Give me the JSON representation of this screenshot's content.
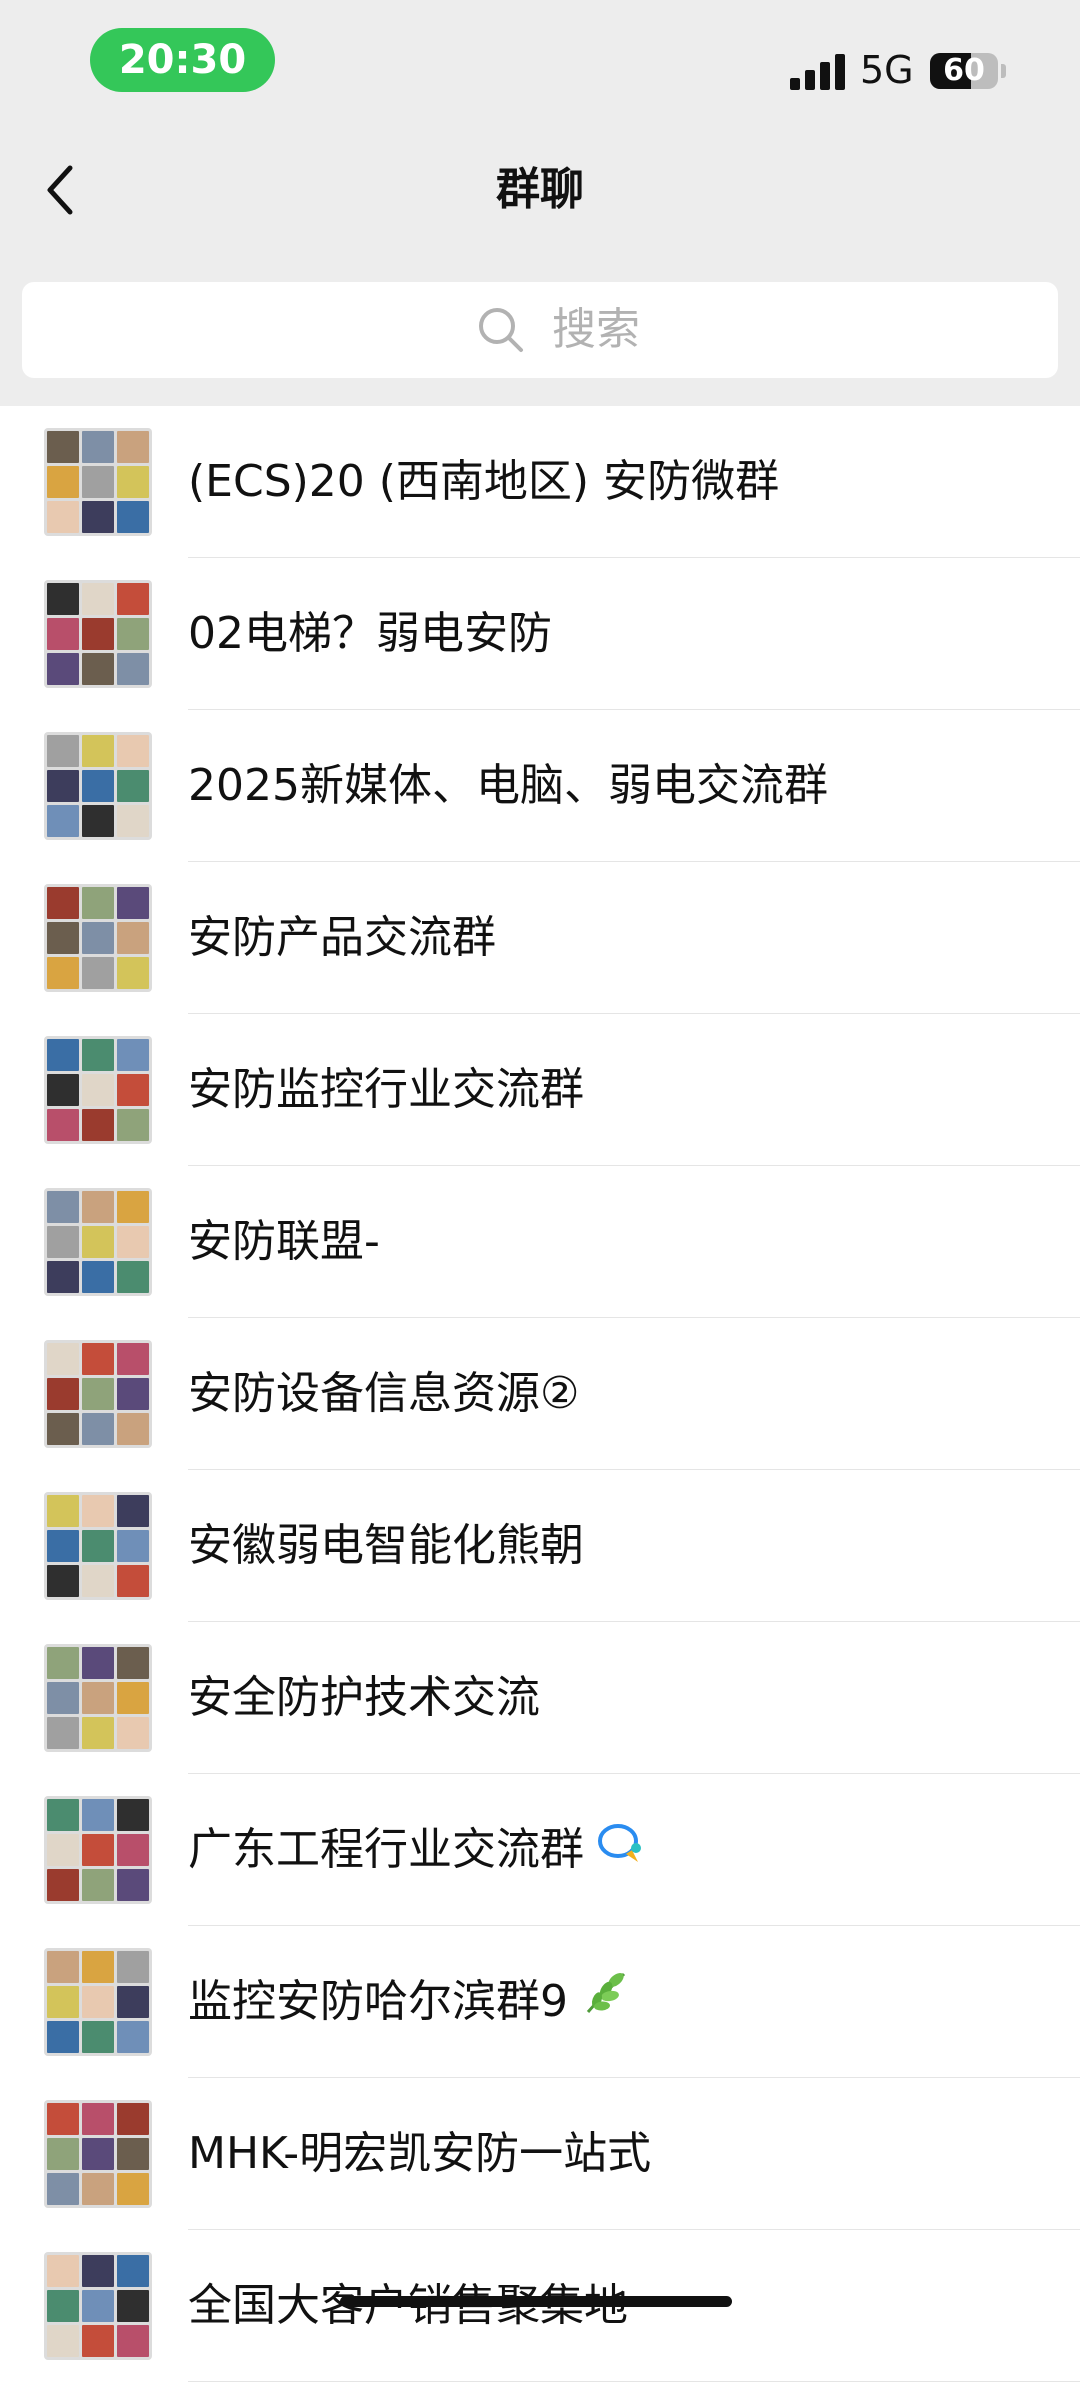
{
  "status_bar": {
    "time": "20:30",
    "network": "5G",
    "battery": "60",
    "battery_level": 0.6
  },
  "nav": {
    "title": "群聊"
  },
  "search": {
    "placeholder": "搜索"
  },
  "groups": [
    {
      "name": "(ECS)20 (西南地区) 安防微群",
      "badge": ""
    },
    {
      "name": "02电梯？弱电安防",
      "badge": ""
    },
    {
      "name": "2025新媒体、电脑、弱电交流群",
      "badge": ""
    },
    {
      "name": "安防产品交流群",
      "badge": ""
    },
    {
      "name": "安防监控行业交流群",
      "badge": ""
    },
    {
      "name": "安防联盟-",
      "badge": ""
    },
    {
      "name": "安防设备信息资源②",
      "badge": ""
    },
    {
      "name": "安徽弱电智能化熊朝",
      "badge": ""
    },
    {
      "name": "安全防护技术交流",
      "badge": ""
    },
    {
      "name": "广东工程行业交流群",
      "badge": "chat-bubble-icon"
    },
    {
      "name": "监控安防哈尔滨群9",
      "badge": "leaf-emoji-icon"
    },
    {
      "name": "MHK-明宏凯安防一站式",
      "badge": ""
    },
    {
      "name": "全国大客户销售聚集地",
      "badge": ""
    }
  ]
}
